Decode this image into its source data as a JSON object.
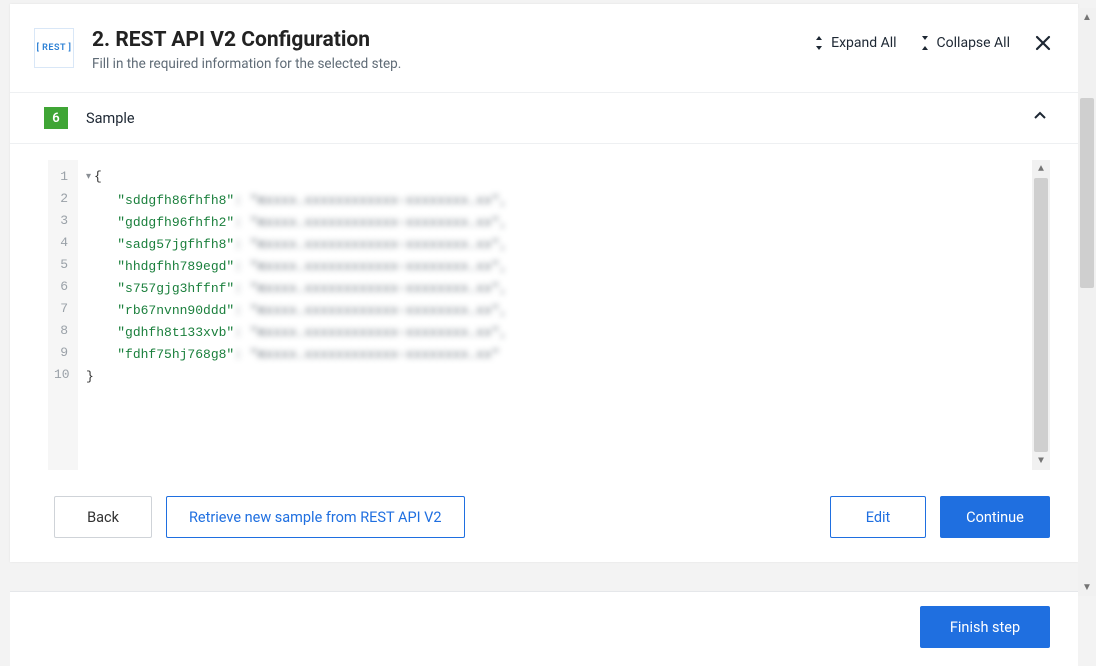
{
  "header": {
    "icon_label": "[ REST ]",
    "title": "2. REST API V2 Configuration",
    "subtitle": "Fill in the required information for the selected step.",
    "expand_all": "Expand All",
    "collapse_all": "Collapse All"
  },
  "section": {
    "number": "6",
    "label": "Sample"
  },
  "code": {
    "lines": [
      {
        "n": "1",
        "fold": true,
        "text_pre": "{",
        "key": "",
        "blur": ""
      },
      {
        "n": "2",
        "fold": false,
        "text_pre": "    ",
        "key": "\"sddgfh86fhfh8\"",
        "blur": ": \"mxxxx.xxxxxxxxxxxx-xxxxxxxx.xx\","
      },
      {
        "n": "3",
        "fold": false,
        "text_pre": "    ",
        "key": "\"gddgfh96fhfh2\"",
        "blur": ": \"mxxxx.xxxxxxxxxxxx-xxxxxxxx.xx\","
      },
      {
        "n": "4",
        "fold": false,
        "text_pre": "    ",
        "key": "\"sadg57jgfhfh8\"",
        "blur": ": \"mxxxx.xxxxxxxxxxxx-xxxxxxxx.xx\","
      },
      {
        "n": "5",
        "fold": false,
        "text_pre": "    ",
        "key": "\"hhdgfhh789egd\"",
        "blur": ": \"mxxxx.xxxxxxxxxxxx-xxxxxxxx.xx\","
      },
      {
        "n": "6",
        "fold": false,
        "text_pre": "    ",
        "key": "\"s757gjg3hffnf\"",
        "blur": ": \"mxxxx.xxxxxxxxxxxx-xxxxxxxx.xx\","
      },
      {
        "n": "7",
        "fold": false,
        "text_pre": "    ",
        "key": "\"rb67nvnn90ddd\"",
        "blur": ": \"mxxxx.xxxxxxxxxxxx-xxxxxxxx.xx\","
      },
      {
        "n": "8",
        "fold": false,
        "text_pre": "    ",
        "key": "\"gdhfh8t133xvb\"",
        "blur": ": \"mxxxx.xxxxxxxxxxxx-xxxxxxxx.xx\","
      },
      {
        "n": "9",
        "fold": false,
        "text_pre": "    ",
        "key": "\"fdhf75hj768g8\"",
        "blur": ": \"mxxxx.xxxxxxxxxxxx-xxxxxxxx.xx\""
      },
      {
        "n": "10",
        "fold": false,
        "text_pre": "}",
        "key": "",
        "blur": ""
      }
    ]
  },
  "buttons": {
    "back": "Back",
    "retrieve": "Retrieve new sample from REST API V2",
    "edit": "Edit",
    "continue": "Continue",
    "finish": "Finish step"
  }
}
